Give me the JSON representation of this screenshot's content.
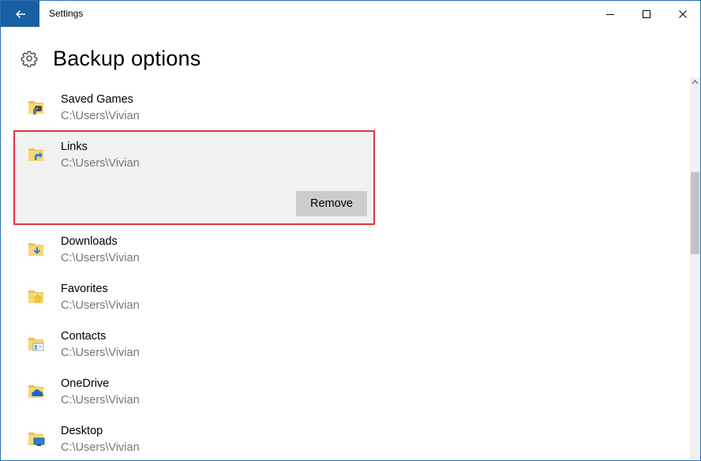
{
  "window": {
    "title": "Settings",
    "accent_color": "#1a5fa3"
  },
  "page": {
    "title": "Backup options"
  },
  "folders": [
    {
      "name": "Saved Games",
      "path": "C:\\Users\\Vivian",
      "icon": "saved-games-folder-icon"
    },
    {
      "name": "Links",
      "path": "C:\\Users\\Vivian",
      "icon": "links-folder-icon",
      "selected": true,
      "action_label": "Remove"
    },
    {
      "name": "Downloads",
      "path": "C:\\Users\\Vivian",
      "icon": "downloads-folder-icon"
    },
    {
      "name": "Favorites",
      "path": "C:\\Users\\Vivian",
      "icon": "favorites-folder-icon"
    },
    {
      "name": "Contacts",
      "path": "C:\\Users\\Vivian",
      "icon": "contacts-folder-icon"
    },
    {
      "name": "OneDrive",
      "path": "C:\\Users\\Vivian",
      "icon": "onedrive-folder-icon"
    },
    {
      "name": "Desktop",
      "path": "C:\\Users\\Vivian",
      "icon": "desktop-folder-icon"
    }
  ],
  "highlight_color": "#e0353b"
}
